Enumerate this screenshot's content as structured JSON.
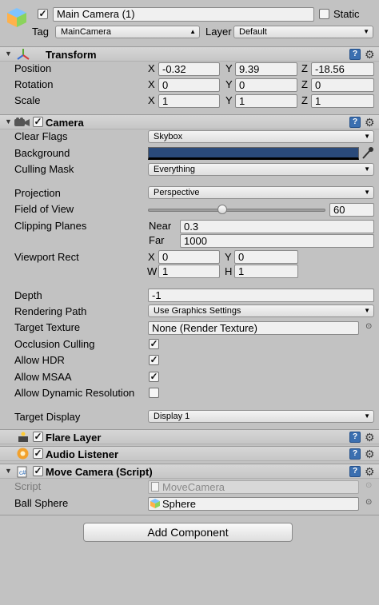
{
  "top": {
    "name": "Main Camera (1)",
    "static_label": "Static",
    "tag_label": "Tag",
    "tag_value": "MainCamera",
    "layer_label": "Layer",
    "layer_value": "Default"
  },
  "transform": {
    "title": "Transform",
    "position_label": "Position",
    "rotation_label": "Rotation",
    "scale_label": "Scale",
    "x": "X",
    "y": "Y",
    "z": "Z",
    "position": [
      "-0.32",
      "9.39",
      "-18.56"
    ],
    "rotation": [
      "0",
      "0",
      "0"
    ],
    "scale": [
      "1",
      "1",
      "1"
    ]
  },
  "camera": {
    "title": "Camera",
    "clear_flags_label": "Clear Flags",
    "clear_flags_value": "Skybox",
    "background_label": "Background",
    "background_color": "#2a4a7a",
    "culling_mask_label": "Culling Mask",
    "culling_mask_value": "Everything",
    "projection_label": "Projection",
    "projection_value": "Perspective",
    "fov_label": "Field of View",
    "fov_value": "60",
    "fov_fraction": 0.42,
    "clipping_label": "Clipping Planes",
    "near_label": "Near",
    "near_value": "0.3",
    "far_label": "Far",
    "far_value": "1000",
    "viewport_label": "Viewport Rect",
    "vx_label": "X",
    "vy_label": "Y",
    "vw_label": "W",
    "vh_label": "H",
    "vx": "0",
    "vy": "0",
    "vw": "1",
    "vh": "1",
    "depth_label": "Depth",
    "depth_value": "-1",
    "rendering_path_label": "Rendering Path",
    "rendering_path_value": "Use Graphics Settings",
    "target_texture_label": "Target Texture",
    "target_texture_value": "None (Render Texture)",
    "occlusion_label": "Occlusion Culling",
    "hdr_label": "Allow HDR",
    "msaa_label": "Allow MSAA",
    "dynres_label": "Allow Dynamic Resolution",
    "target_display_label": "Target Display",
    "target_display_value": "Display 1"
  },
  "flare": {
    "title": "Flare Layer"
  },
  "audio": {
    "title": "Audio Listener"
  },
  "move": {
    "title": "Move Camera (Script)",
    "script_label": "Script",
    "script_value": "MoveCamera",
    "ball_label": "Ball Sphere",
    "ball_value": "Sphere"
  },
  "add_component": "Add Component",
  "icons": {
    "help": "?",
    "gear": "⚙",
    "check": "✓",
    "dropdown_arrow": "▲▼"
  }
}
